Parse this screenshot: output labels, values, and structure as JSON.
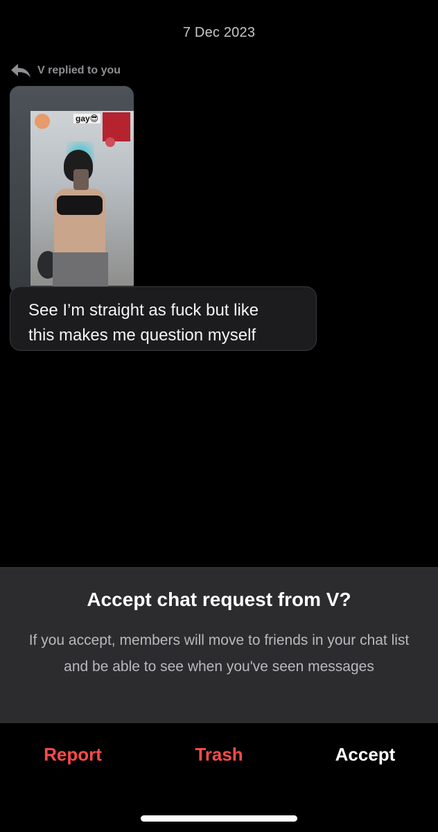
{
  "chat": {
    "date": "7 Dec 2023",
    "reply_header": {
      "icon": "reply-arrow-icon",
      "text": "V replied to you"
    },
    "replied_photo": {
      "sticker_text": "gay😎"
    },
    "message": {
      "text": "See I’m straight as fuck but like\nthis makes me question myself"
    }
  },
  "request_panel": {
    "title": "Accept chat request from V?",
    "body": "If you accept, members will move to friends in your chat list and be able to see when you've seen messages"
  },
  "actions": {
    "report": "Report",
    "trash": "Trash",
    "accept": "Accept"
  },
  "colors": {
    "background": "#000000",
    "panel": "#2c2c2e",
    "destructive": "#ff4a4a",
    "muted_text": "#8e8e93"
  }
}
